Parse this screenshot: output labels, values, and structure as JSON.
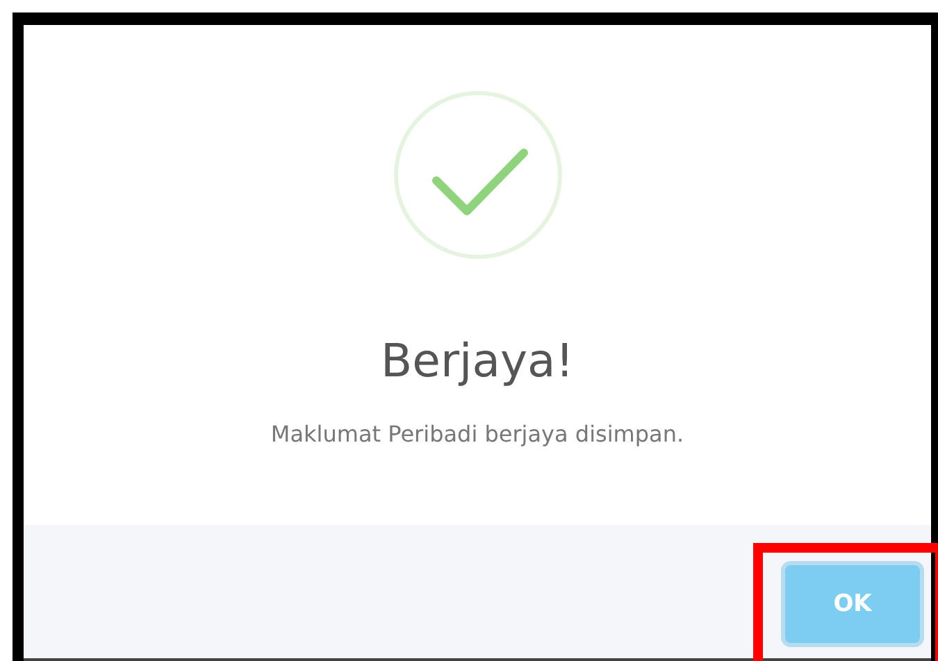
{
  "dialog": {
    "title": "Berjaya!",
    "message": "Maklumat Peribadi berjaya disimpan."
  },
  "button": {
    "label": "OK",
    "highlighted": true
  }
}
